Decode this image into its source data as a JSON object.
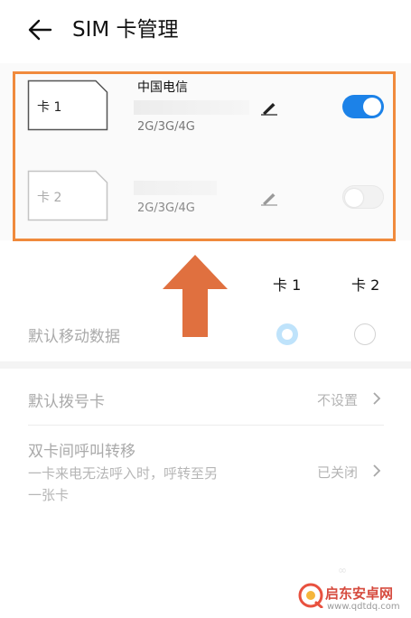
{
  "header": {
    "title": "SIM 卡管理"
  },
  "sims": [
    {
      "card_label": "卡 1",
      "carrier": "中国电信",
      "network": "2G/3G/4G",
      "enabled": true
    },
    {
      "card_label": "卡 2",
      "carrier": "",
      "network": "2G/3G/4G",
      "enabled": false
    }
  ],
  "columns": {
    "sim1": "卡 1",
    "sim2": "卡 2"
  },
  "rows": {
    "default_data": {
      "label": "默认移动数据",
      "selected": "卡 1"
    },
    "default_dial": {
      "label": "默认拨号卡",
      "value": "不设置"
    },
    "call_forward": {
      "label": "双卡间呼叫转移",
      "desc_line1": "一卡来电无法呼入时，呼转至另",
      "desc_line2": "一张卡",
      "value": "已关闭"
    }
  },
  "watermark": {
    "name": "启东安卓网",
    "url": "www.qdtdq.com"
  },
  "colors": {
    "accent": "#1c82e8",
    "highlight": "#f08a3c",
    "arrow": "#e0703f"
  },
  "icons": [
    "back-arrow-icon",
    "sim-card-icon",
    "edit-pencil-icon",
    "chevron-right-icon",
    "up-arrow-icon"
  ]
}
